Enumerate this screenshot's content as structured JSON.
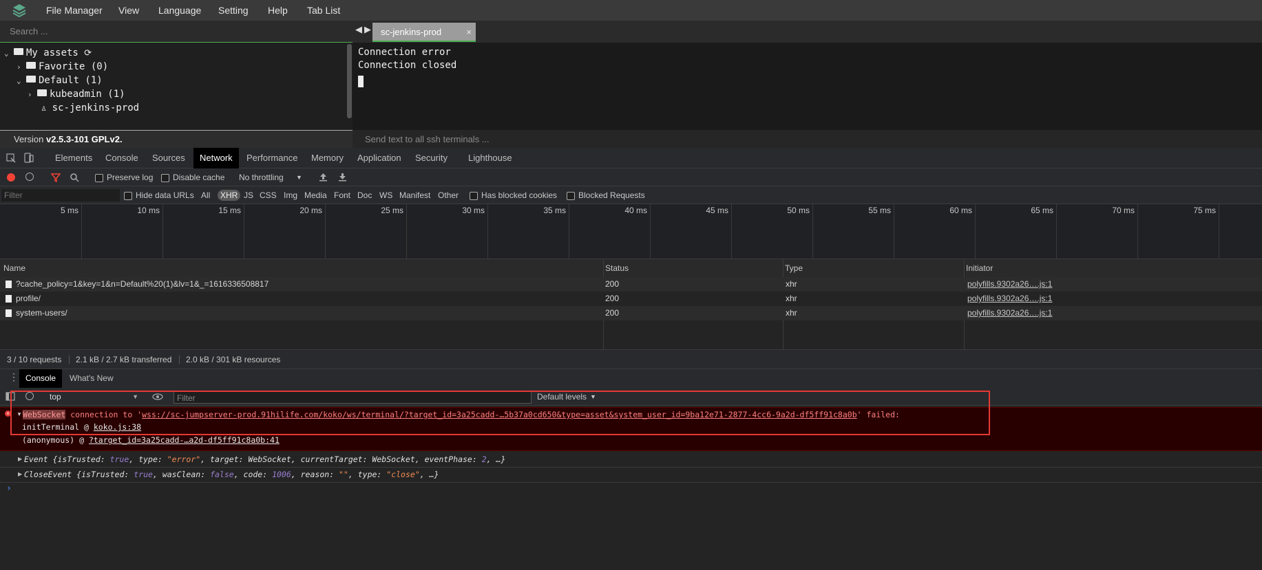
{
  "app": {
    "menu": [
      "File Manager",
      "View",
      "Language",
      "Setting",
      "Help",
      "Tab List"
    ],
    "search_placeholder": "Search ...",
    "tree": {
      "root": "My assets",
      "favorite": "Favorite (0)",
      "default": "Default (1)",
      "kubeadmin": "kubeadmin (1)",
      "host": "sc-jenkins-prod"
    },
    "version_prefix": "Version ",
    "version": "v2.5.3-101 GPLv2.",
    "tab_title": "sc-jenkins-prod",
    "tab_close": "×",
    "terminal_lines": [
      "Connection error",
      "Connection closed"
    ],
    "send_placeholder": "Send text to all ssh terminals ..."
  },
  "devtools": {
    "tabs": [
      "Elements",
      "Console",
      "Sources",
      "Network",
      "Performance",
      "Memory",
      "Application",
      "Security",
      "Lighthouse"
    ],
    "active_tab": "Network",
    "toolbar": {
      "preserve_log": "Preserve log",
      "disable_cache": "Disable cache",
      "throttling": "No throttling"
    },
    "filter": {
      "placeholder": "Filter",
      "hide_data_urls": "Hide data URLs",
      "types": [
        "All",
        "XHR",
        "JS",
        "CSS",
        "Img",
        "Media",
        "Font",
        "Doc",
        "WS",
        "Manifest",
        "Other"
      ],
      "active_type": "XHR",
      "has_blocked_cookies": "Has blocked cookies",
      "blocked_requests": "Blocked Requests"
    },
    "timeline_ticks": [
      "5 ms",
      "10 ms",
      "15 ms",
      "20 ms",
      "25 ms",
      "30 ms",
      "35 ms",
      "40 ms",
      "45 ms",
      "50 ms",
      "55 ms",
      "60 ms",
      "65 ms",
      "70 ms",
      "75 ms"
    ],
    "table": {
      "headers": [
        "Name",
        "Status",
        "Type",
        "Initiator"
      ],
      "rows": [
        {
          "name": "?cache_policy=1&key=1&n=Default%20(1)&lv=1&_=1616336508817",
          "status": "200",
          "type": "xhr",
          "initiator": "polyfills.9302a26….js:1"
        },
        {
          "name": "profile/",
          "status": "200",
          "type": "xhr",
          "initiator": "polyfills.9302a26….js:1"
        },
        {
          "name": "system-users/",
          "status": "200",
          "type": "xhr",
          "initiator": "polyfills.9302a26….js:1"
        }
      ]
    },
    "status_bar": [
      "3 / 10 requests",
      "2.1 kB / 2.7 kB transferred",
      "2.0 kB / 301 kB resources"
    ],
    "drawer_tabs": [
      "Console",
      "What's New"
    ],
    "console": {
      "context": "top",
      "filter_placeholder": "Filter",
      "levels": "Default levels",
      "error": {
        "websocket": "WebSocket",
        "text1": " connection to '",
        "url": "wss://sc-jumpserver-prod.91hilife.com/koko/ws/terminal/?target_id=3a25cadd-…5b37a0cd650&type=asset&system_user_id=9ba12e71-2877-4cc6-9a2d-df5ff91c8a0b",
        "text2": "' failed:",
        "stack1_fn": "initTerminal @ ",
        "stack1_link": "koko.js:38",
        "stack2_fn": "(anonymous) @ ",
        "stack2_link": "?target_id=3a25cadd-…a2d-df5ff91c8a0b:41"
      },
      "event_line": {
        "name": "Event ",
        "p1": "{isTrusted: ",
        "v1": "true",
        "p2": ", type: ",
        "v2": "\"error\"",
        "p3": ", target: WebSocket, currentTarget: WebSocket, eventPhase: ",
        "v3": "2",
        "p4": ", …}"
      },
      "close_line": {
        "name": "CloseEvent ",
        "p1": "{isTrusted: ",
        "v1": "true",
        "p2": ", wasClean: ",
        "v2": "false",
        "p3": ", code: ",
        "v3": "1006",
        "p4": ", reason: ",
        "v4": "\"\"",
        "p5": ", type: ",
        "v5": "\"close\"",
        "p6": ", …}"
      },
      "prompt": "›"
    }
  },
  "colors": {
    "accent_green": "#4caf50",
    "error_red": "#e53935",
    "record_red": "#f44336"
  }
}
